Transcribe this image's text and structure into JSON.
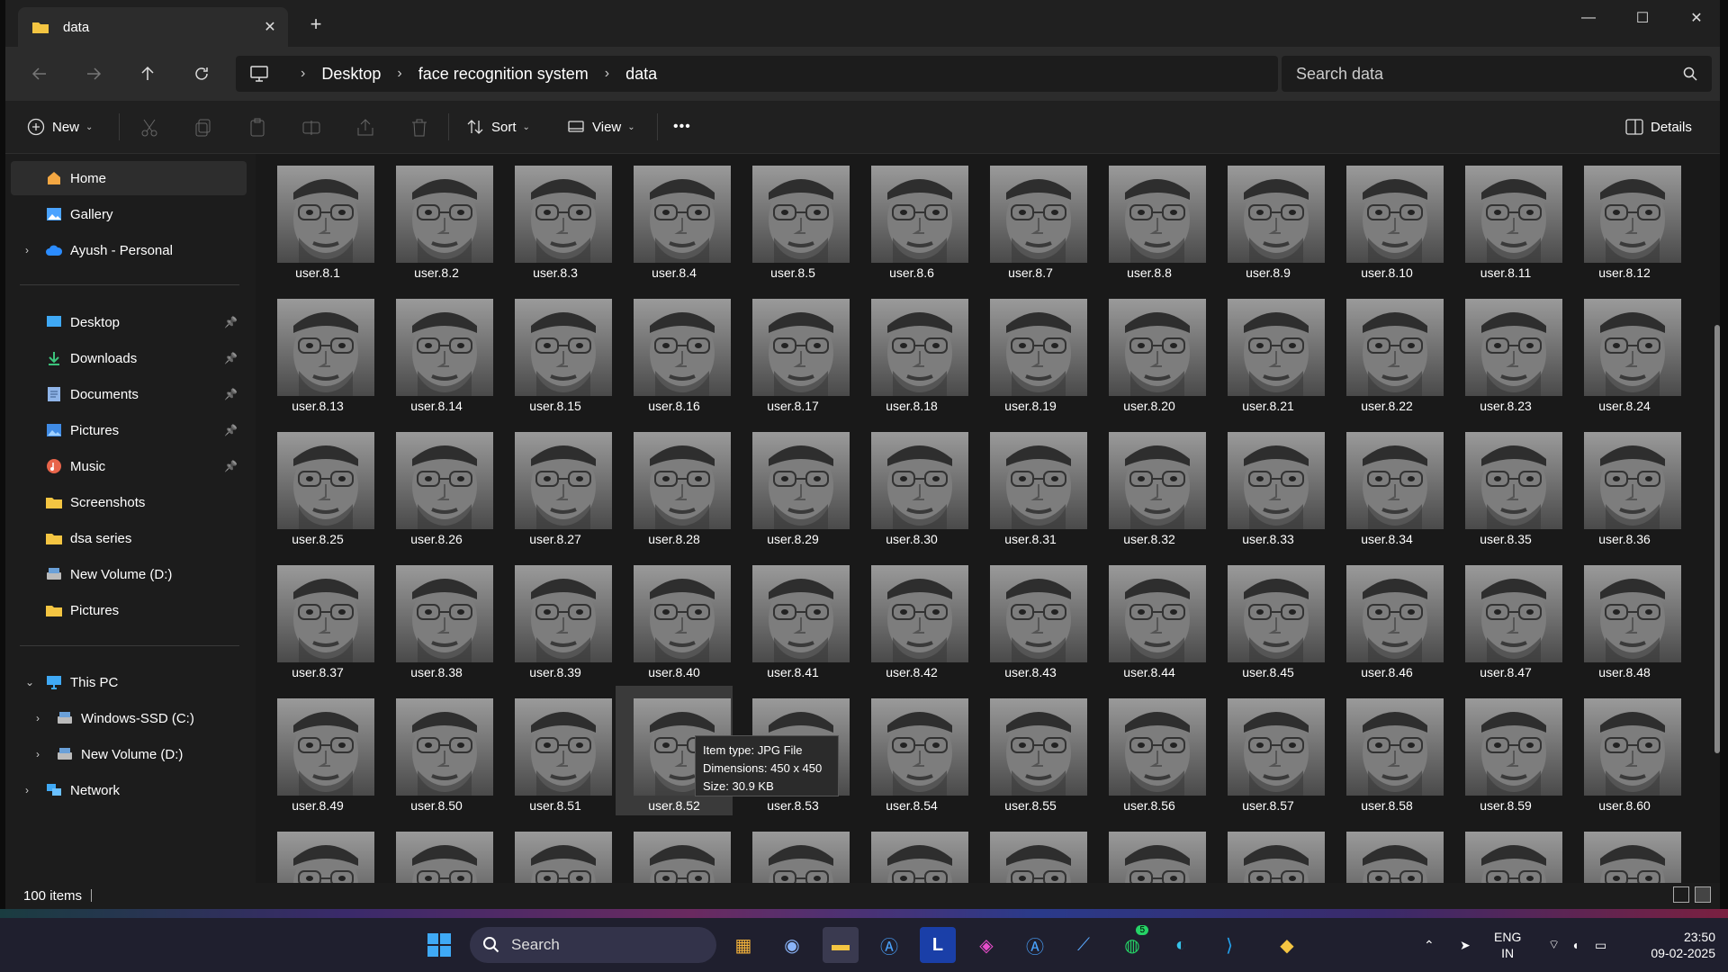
{
  "window": {
    "tab_title": "data",
    "new_tab": "+"
  },
  "nav": {
    "breadcrumbs": [
      "Desktop",
      "face recognition system",
      "data"
    ],
    "search_placeholder": "Search data"
  },
  "cmdbar": {
    "new_label": "New",
    "sort_label": "Sort",
    "view_label": "View",
    "more_label": "•••",
    "details_label": "Details"
  },
  "sidebar": {
    "top": [
      {
        "label": "Home",
        "icon": "home-icon",
        "active": true
      },
      {
        "label": "Gallery",
        "icon": "gallery-icon"
      },
      {
        "label": "Ayush - Personal",
        "icon": "cloud-icon",
        "expandable": true
      }
    ],
    "quick": [
      {
        "label": "Desktop",
        "icon": "desktop-icon",
        "pinned": true
      },
      {
        "label": "Downloads",
        "icon": "download-icon",
        "pinned": true
      },
      {
        "label": "Documents",
        "icon": "documents-icon",
        "pinned": true
      },
      {
        "label": "Pictures",
        "icon": "pictures-icon",
        "pinned": true
      },
      {
        "label": "Music",
        "icon": "music-icon",
        "pinned": true
      },
      {
        "label": "Screenshots",
        "icon": "folder-icon"
      },
      {
        "label": "dsa series",
        "icon": "folder-icon"
      },
      {
        "label": "New Volume (D:)",
        "icon": "drive-icon"
      },
      {
        "label": "Pictures",
        "icon": "folder-icon"
      }
    ],
    "tree": [
      {
        "label": "This PC",
        "icon": "pc-icon",
        "expanded": true
      },
      {
        "label": "Windows-SSD (C:)",
        "icon": "drive-icon",
        "child": true
      },
      {
        "label": "New Volume (D:)",
        "icon": "drive-icon",
        "child": true
      },
      {
        "label": "Network",
        "icon": "network-icon"
      }
    ]
  },
  "files": {
    "prefix": "user.8.",
    "visible_labeled": 60,
    "partial_row": 12,
    "selected": "user.8.52"
  },
  "tooltip": {
    "type": "Item type: JPG File",
    "dimensions": "Dimensions: 450 x 450",
    "size": "Size: 30.9 KB"
  },
  "status": {
    "item_count": "100 items"
  },
  "taskbar": {
    "search_label": "Search",
    "lang_top": "ENG",
    "lang_bottom": "IN",
    "time": "23:50",
    "date": "09-02-2025",
    "whatsapp_badge": "5"
  },
  "colors": {
    "accent": "#0078d4",
    "folder": "#f4c542"
  }
}
